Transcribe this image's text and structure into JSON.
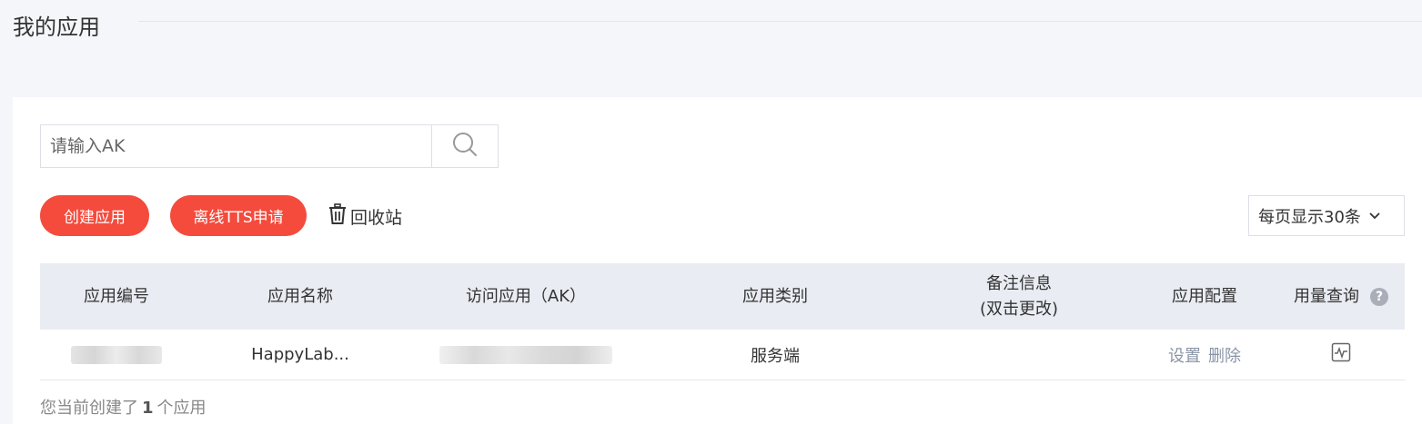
{
  "page": {
    "title": "我的应用"
  },
  "search": {
    "placeholder": "请输入AK",
    "value": ""
  },
  "toolbar": {
    "create_label": "创建应用",
    "tts_label": "离线TTS申请",
    "recycle_label": "回收站",
    "page_size_label": "每页显示30条"
  },
  "table": {
    "headers": {
      "id": "应用编号",
      "name": "应用名称",
      "ak": "访问应用（AK）",
      "category": "应用类别",
      "note_line1": "备注信息",
      "note_line2": "(双击更改)",
      "config": "应用配置",
      "usage": "用量查询"
    },
    "rows": [
      {
        "name": "HappyLab...",
        "category": "服务端",
        "note": "",
        "config_set": "设置",
        "config_delete": "删除"
      }
    ]
  },
  "footer": {
    "prefix": "您当前创建了",
    "count": "1",
    "suffix": "个应用"
  },
  "icons": {
    "search": "search-icon",
    "trash": "trash-icon",
    "chevron": "chevron-down-icon",
    "help": "help-icon",
    "chart": "chart-icon"
  },
  "colors": {
    "accent": "#f44b3c",
    "header_bg": "#e9ecf2",
    "link": "#8a94a6"
  }
}
